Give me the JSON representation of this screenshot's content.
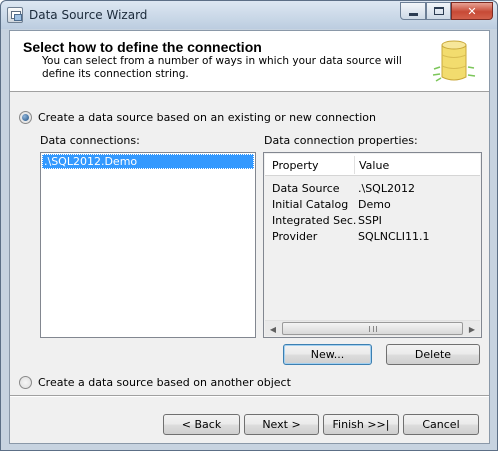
{
  "window": {
    "title": "Data Source Wizard"
  },
  "header": {
    "title": "Select how to define the connection",
    "description": "You can select from a number of ways in which your data source will define its connection string."
  },
  "options": {
    "existing_label": "Create a data source based on an existing or new connection",
    "existing_selected": true,
    "other_label": "Create a data source based on another object",
    "other_selected": false
  },
  "connections": {
    "label": "Data connections:",
    "items": [
      ".\\SQL2012.Demo"
    ],
    "selected_index": 0
  },
  "properties": {
    "label": "Data connection properties:",
    "columns": [
      "Property",
      "Value"
    ],
    "rows": [
      {
        "name": "Data Source",
        "value": ".\\SQL2012"
      },
      {
        "name": "Initial Catalog",
        "value": "Demo"
      },
      {
        "name": "Integrated Sec...",
        "value": "SSPI"
      },
      {
        "name": "Provider",
        "value": "SQLNCLI11.1"
      }
    ]
  },
  "buttons": {
    "new": "New...",
    "delete": "Delete",
    "back": "< Back",
    "next": "Next >",
    "finish": "Finish >>|",
    "cancel": "Cancel"
  },
  "icons": {
    "app": "wizard-window-icon",
    "header": "database-icon",
    "minimize": "minimize-icon",
    "maximize": "maximize-icon",
    "close": "close-icon"
  },
  "colors": {
    "selection": "#3399ff",
    "close_button": "#c74a36",
    "header_icon": "#e8c94a"
  }
}
